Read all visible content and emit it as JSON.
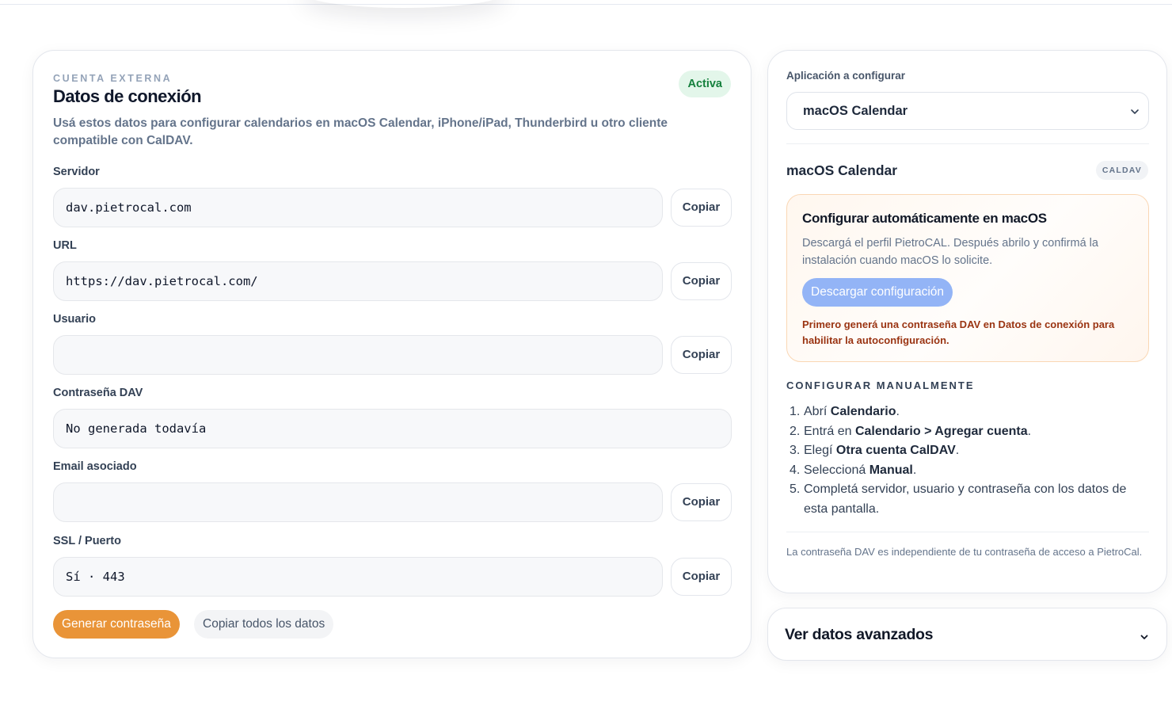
{
  "connection": {
    "eyebrow": "CUENTA EXTERNA",
    "title": "Datos de conexión",
    "status_badge": "Activa",
    "description": "Usá estos datos para configurar calendarios en macOS Calendar, iPhone/iPad, Thunderbird u otro cliente compatible con CalDAV.",
    "copy_label": "Copiar",
    "fields": {
      "server": {
        "label": "Servidor",
        "value": "dav.pietrocal.com"
      },
      "url": {
        "label": "URL",
        "value": "https://dav.pietrocal.com/"
      },
      "user": {
        "label": "Usuario",
        "value": ""
      },
      "password": {
        "label": "Contraseña DAV",
        "value": "No generada todavía"
      },
      "email": {
        "label": "Email asociado",
        "value": ""
      },
      "ssl": {
        "label": "SSL / Puerto",
        "value": "Sí · 443"
      }
    },
    "generate_button": "Generar contraseña",
    "copy_all_button": "Copiar todos los datos"
  },
  "app_config": {
    "label": "Aplicación a configurar",
    "selected": "macOS Calendar",
    "app_name": "macOS Calendar",
    "protocol_badge": "CALDAV",
    "auto": {
      "title": "Configurar automáticamente en macOS",
      "description": "Descargá el perfil PietroCAL. Después abrilo y confirmá la instalación cuando macOS lo solicite.",
      "download_button": "Descargar configuración",
      "warning": "Primero generá una contraseña DAV en Datos de conexión para habilitar la autoconfiguración."
    },
    "manual_title": "CONFIGURAR MANUALMENTE",
    "steps": [
      {
        "num": "1.",
        "pre": "Abrí ",
        "bold": "Calendario",
        "post": "."
      },
      {
        "num": "2.",
        "pre": "Entrá en ",
        "bold": "Calendario > Agregar cuenta",
        "post": "."
      },
      {
        "num": "3.",
        "pre": "Elegí ",
        "bold": "Otra cuenta CalDAV",
        "post": "."
      },
      {
        "num": "4.",
        "pre": "Seleccioná ",
        "bold": "Manual",
        "post": "."
      },
      {
        "num": "5.",
        "pre": "Completá servidor, usuario y contraseña con los datos de esta pantalla.",
        "bold": "",
        "post": ""
      }
    ],
    "note": "La contraseña DAV es independiente de tu contraseña de acceso a PietroCal."
  },
  "advanced": {
    "title": "Ver datos avanzados",
    "icon": "chevron-down-icon"
  },
  "colors": {
    "accent_orange": "#e99438",
    "active_green": "#15803d",
    "download_blue": "#93b4f6",
    "warning_text": "#9a3412"
  }
}
